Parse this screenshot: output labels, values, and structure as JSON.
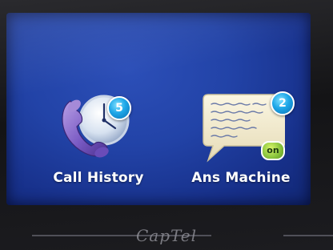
{
  "tiles": [
    {
      "label": "Call History",
      "badge": "5",
      "icon": "phone-clock-icon"
    },
    {
      "label": "Ans Machine",
      "badge": "2",
      "status": "on",
      "icon": "message-bubble-icon"
    }
  ],
  "brand": "CapTel",
  "colors": {
    "screen_bg": "#2243a7",
    "badge": "#1ea7e8",
    "on_pill": "#8cc63f",
    "text": "#ffffff"
  }
}
